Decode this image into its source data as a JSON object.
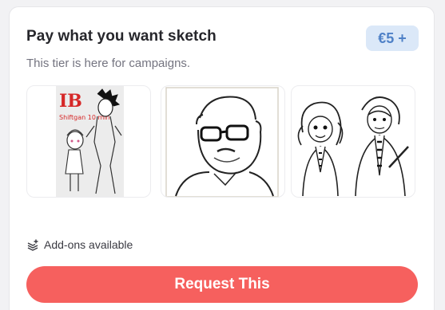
{
  "tier": {
    "title": "Pay what you want sketch",
    "price": "€5 +",
    "description": "This tier is here for campaigns."
  },
  "gallery": {
    "images": [
      {
        "name": "sketch-sample-1",
        "caption": "IB",
        "subcaption": "Shiftgan 10 min"
      },
      {
        "name": "sketch-sample-2"
      },
      {
        "name": "sketch-sample-3"
      }
    ]
  },
  "addons": {
    "icon": "layers-plus-icon",
    "label": "Add-ons available"
  },
  "cta": {
    "label": "Request This",
    "color": "#f6605e"
  },
  "colors": {
    "price_bg": "#dbe8f8",
    "price_text": "#4f81c7",
    "accent_red": "#d62828"
  }
}
